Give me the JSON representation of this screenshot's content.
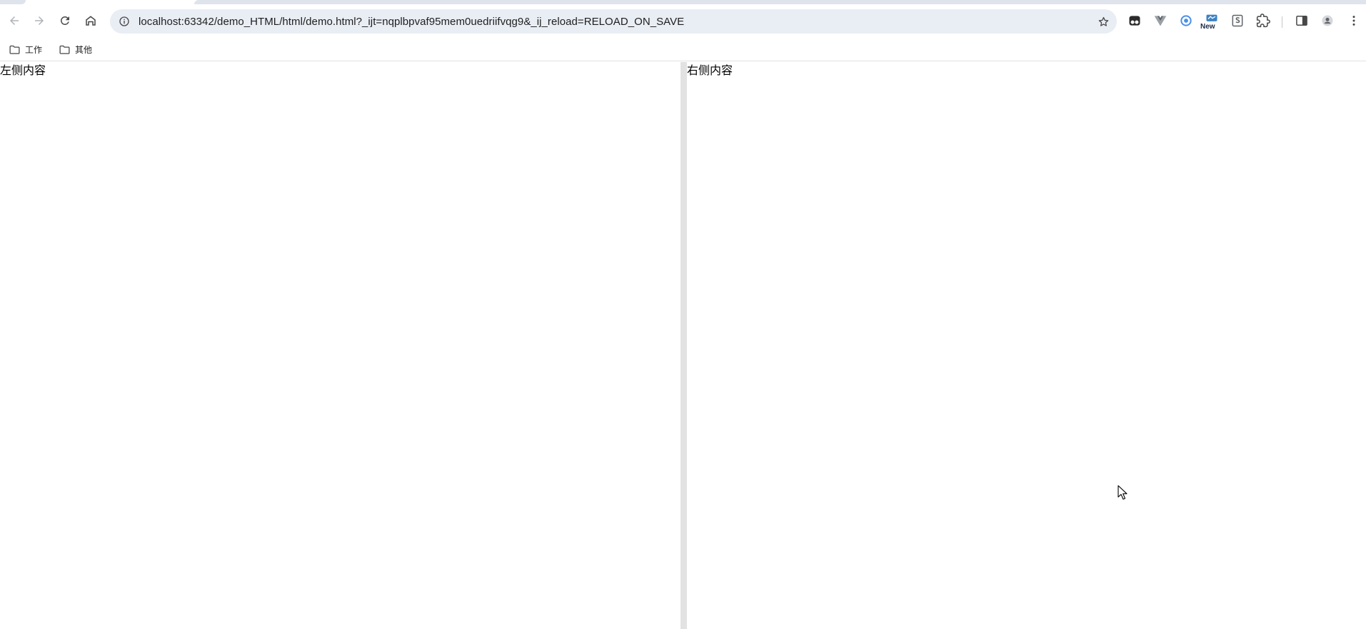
{
  "browser": {
    "url": "localhost:63342/demo_HTML/html/demo.html?_ijt=nqplbpvaf95mem0uedriifvqg9&_ij_reload=RELOAD_ON_SAVE",
    "extensions": [
      {
        "name": "tampermonkey-icon"
      },
      {
        "name": "vue-devtools-icon"
      },
      {
        "name": "record-icon"
      },
      {
        "name": "new-extension-icon",
        "badge": "New"
      },
      {
        "name": "s-extension-icon"
      },
      {
        "name": "extensions-puzzle-icon"
      }
    ]
  },
  "bookmarks": {
    "items": [
      {
        "label": "工作",
        "icon": "folder-icon"
      },
      {
        "label": "其他",
        "icon": "folder-icon"
      }
    ]
  },
  "page": {
    "left_text": "左侧内容",
    "right_text": "右侧内容"
  },
  "colors": {
    "divider": "#e2e2e2",
    "omnibox": "#e9edf4",
    "tabstrip": "#dfe3eb"
  }
}
